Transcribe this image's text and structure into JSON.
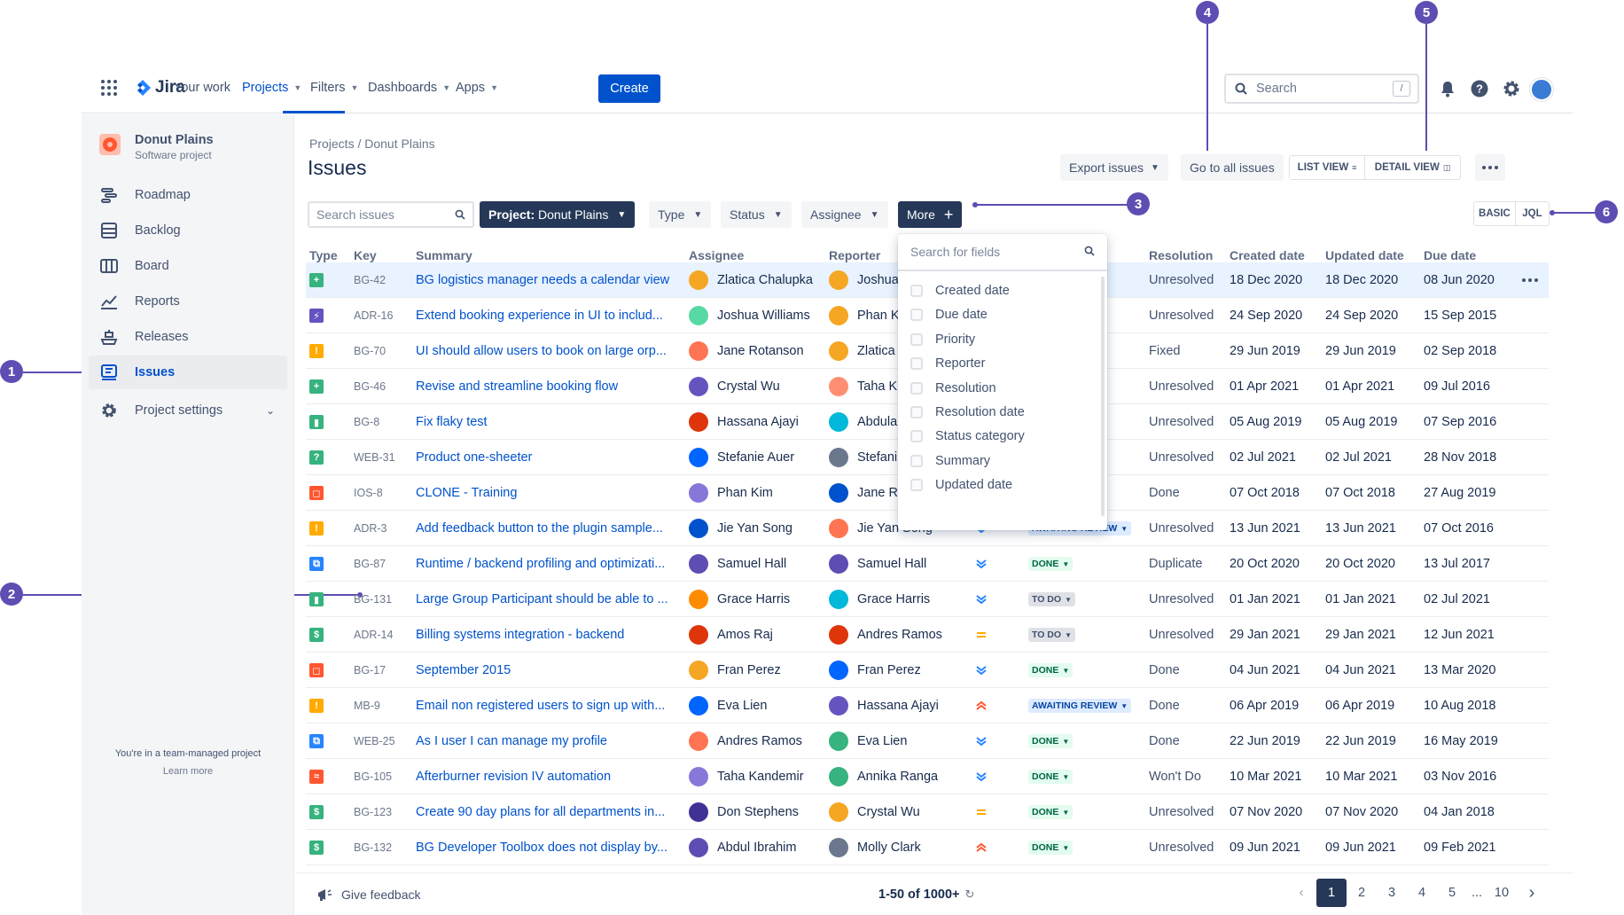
{
  "topnav": {
    "logo_text": "Jira",
    "your_work": "Your work",
    "projects": "Projects",
    "filters": "Filters",
    "dashboards": "Dashboards",
    "apps": "Apps",
    "create": "Create",
    "search_placeholder": "Search",
    "search_shortcut": "/"
  },
  "sidebar": {
    "project_name": "Donut Plains",
    "project_type": "Software project",
    "items": [
      {
        "label": "Roadmap",
        "icon": "roadmap-icon"
      },
      {
        "label": "Backlog",
        "icon": "backlog-icon"
      },
      {
        "label": "Board",
        "icon": "board-icon"
      },
      {
        "label": "Reports",
        "icon": "reports-icon"
      },
      {
        "label": "Releases",
        "icon": "releases-icon"
      },
      {
        "label": "Issues",
        "icon": "issues-icon"
      },
      {
        "label": "Project settings",
        "icon": "gear-icon"
      }
    ],
    "footer_text": "You're in a team-managed project",
    "footer_link": "Learn more"
  },
  "header": {
    "breadcrumb": "Projects / Donut Plains",
    "title": "Issues",
    "export": "Export issues",
    "go_all": "Go to all issues",
    "list_view": "LIST VIEW",
    "detail_view": "DETAIL VIEW"
  },
  "filters": {
    "search_placeholder": "Search issues",
    "project_prefix": "Project:",
    "project_value": "Donut Plains",
    "type": "Type",
    "status": "Status",
    "assignee": "Assignee",
    "more": "More",
    "basic": "BASIC",
    "jql": "JQL"
  },
  "columns": {
    "type": "Type",
    "key": "Key",
    "summary": "Summary",
    "assignee": "Assignee",
    "reporter": "Reporter",
    "resolution": "Resolution",
    "created": "Created date",
    "updated": "Updated date",
    "due": "Due date"
  },
  "dropdown": {
    "search_placeholder": "Search for fields",
    "options": [
      "Created date",
      "Due date",
      "Priority",
      "Reporter",
      "Resolution",
      "Resolution date",
      "Status category",
      "Summary",
      "Updated date"
    ]
  },
  "rows": [
    {
      "type": "story",
      "type_color": "#36b37e",
      "type_glyph": "+",
      "key": "BG-42",
      "summary": "BG logistics manager needs a calendar view",
      "assignee": "Zlatica Chalupka",
      "a_color": "#f5a623",
      "reporter": "Joshua",
      "r_color": "#f5a623",
      "priority": "",
      "status": "",
      "status_kind": "",
      "resolution": "Unresolved",
      "created": "18 Dec 2020",
      "updated": "18 Dec 2020",
      "due": "08 Jun 2020"
    },
    {
      "type": "epic",
      "type_color": "#6554c0",
      "type_glyph": "⚡",
      "key": "ADR-16",
      "summary": "Extend booking experience in UI to includ...",
      "assignee": "Joshua Williams",
      "a_color": "#57d9a3",
      "reporter": "Phan K",
      "r_color": "#f5a623",
      "priority": "",
      "status": "",
      "status_kind": "",
      "resolution": "Unresolved",
      "created": "24 Sep 2020",
      "updated": "24 Sep 2020",
      "due": "15 Sep 2015"
    },
    {
      "type": "idea",
      "type_color": "#ffab00",
      "type_glyph": "!",
      "key": "BG-70",
      "summary": "UI should allow users to book on large orp...",
      "assignee": "Jane Rotanson",
      "a_color": "#ff7452",
      "reporter": "Zlatica",
      "r_color": "#f5a623",
      "priority": "",
      "status": "",
      "status_kind": "",
      "resolution": "Fixed",
      "created": "29 Jun 2019",
      "updated": "29 Jun 2019",
      "due": "02 Sep 2018"
    },
    {
      "type": "story",
      "type_color": "#36b37e",
      "type_glyph": "+",
      "key": "BG-46",
      "summary": "Revise and streamline booking flow",
      "assignee": "Crystal Wu",
      "a_color": "#6554c0",
      "reporter": "Taha K",
      "r_color": "#ff8f73",
      "priority": "",
      "status": "",
      "status_kind": "",
      "resolution": "Unresolved",
      "created": "01 Apr 2021",
      "updated": "01 Apr 2021",
      "due": "09 Jul 2016"
    },
    {
      "type": "bookmark",
      "type_color": "#36b37e",
      "type_glyph": "▮",
      "key": "BG-8",
      "summary": "Fix flaky test",
      "assignee": "Hassana Ajayi",
      "a_color": "#de350b",
      "reporter": "Abdula",
      "r_color": "#00b8d9",
      "priority": "",
      "status": "",
      "status_kind": "",
      "resolution": "Unresolved",
      "created": "05 Aug 2019",
      "updated": "05 Aug 2019",
      "due": "07 Sep 2016"
    },
    {
      "type": "question",
      "type_color": "#36b37e",
      "type_glyph": "?",
      "key": "WEB-31",
      "summary": "Product one-sheeter",
      "assignee": "Stefanie Auer",
      "a_color": "#0065ff",
      "reporter": "Stefani",
      "r_color": "#6b778c",
      "priority": "",
      "status": "",
      "status_kind": "",
      "resolution": "Unresolved",
      "created": "02 Jul 2021",
      "updated": "02 Jul 2021",
      "due": "28 Nov 2018"
    },
    {
      "type": "bug",
      "type_color": "#ff5630",
      "type_glyph": "◻",
      "key": "IOS-8",
      "summary": "CLONE - Training",
      "assignee": "Phan Kim",
      "a_color": "#8777d9",
      "reporter": "Jane R",
      "r_color": "#0052cc",
      "priority": "",
      "status": "",
      "status_kind": "",
      "resolution": "Done",
      "created": "07 Oct 2018",
      "updated": "07 Oct 2018",
      "due": "27 Aug 2019"
    },
    {
      "type": "idea",
      "type_color": "#ffab00",
      "type_glyph": "!",
      "key": "ADR-3",
      "summary": "Add feedback button to the plugin sample...",
      "assignee": "Jie Yan Song",
      "a_color": "#0052cc",
      "reporter": "Jie Yan Song",
      "r_color": "#ff7452",
      "priority": "low",
      "status": "AWAITING REVIEW",
      "status_kind": "awaiting",
      "resolution": "Unresolved",
      "created": "13 Jun 2021",
      "updated": "13 Jun 2021",
      "due": "07 Oct 2016"
    },
    {
      "type": "subtask",
      "type_color": "#2684ff",
      "type_glyph": "⧉",
      "key": "BG-87",
      "summary": "Runtime / backend profiling and optimizati...",
      "assignee": "Samuel Hall",
      "a_color": "#5e4db2",
      "reporter": "Samuel Hall",
      "r_color": "#5e4db2",
      "priority": "low",
      "status": "DONE",
      "status_kind": "done",
      "resolution": "Duplicate",
      "created": "20 Oct 2020",
      "updated": "20 Oct 2020",
      "due": "13 Jul 2017"
    },
    {
      "type": "bookmark",
      "type_color": "#36b37e",
      "type_glyph": "▮",
      "key": "BG-131",
      "summary": "Large Group Participant should be able to ...",
      "assignee": "Grace Harris",
      "a_color": "#ff8b00",
      "reporter": "Grace Harris",
      "r_color": "#00b8d9",
      "priority": "low",
      "status": "TO DO",
      "status_kind": "todo",
      "resolution": "Unresolved",
      "created": "01 Jan 2021",
      "updated": "01 Jan 2021",
      "due": "02 Jul 2021"
    },
    {
      "type": "dollar",
      "type_color": "#36b37e",
      "type_glyph": "$",
      "key": "ADR-14",
      "summary": "Billing systems integration - backend",
      "assignee": "Amos Raj",
      "a_color": "#de350b",
      "reporter": "Andres Ramos",
      "r_color": "#de350b",
      "priority": "medium",
      "status": "TO DO",
      "status_kind": "todo",
      "resolution": "Unresolved",
      "created": "29 Jan 2021",
      "updated": "29 Jan 2021",
      "due": "12 Jun 2021"
    },
    {
      "type": "bug",
      "type_color": "#ff5630",
      "type_glyph": "◻",
      "key": "BG-17",
      "summary": "September 2015",
      "assignee": "Fran Perez",
      "a_color": "#f5a623",
      "reporter": "Fran Perez",
      "r_color": "#0065ff",
      "priority": "low",
      "status": "DONE",
      "status_kind": "done",
      "resolution": "Done",
      "created": "04 Jun 2021",
      "updated": "04 Jun 2021",
      "due": "13 Mar 2020"
    },
    {
      "type": "idea",
      "type_color": "#ffab00",
      "type_glyph": "!",
      "key": "MB-9",
      "summary": "Email non registered users to sign up with...",
      "assignee": "Eva Lien",
      "a_color": "#0065ff",
      "reporter": "Hassana Ajayi",
      "r_color": "#6554c0",
      "priority": "high",
      "status": "AWAITING REVIEW",
      "status_kind": "awaiting",
      "resolution": "Done",
      "created": "06 Apr 2019",
      "updated": "06 Apr 2019",
      "due": "10 Aug 2018"
    },
    {
      "type": "subtask",
      "type_color": "#2684ff",
      "type_glyph": "⧉",
      "key": "WEB-25",
      "summary": "As I user I can manage my profile",
      "assignee": "Andres Ramos",
      "a_color": "#ff7452",
      "reporter": "Eva Lien",
      "r_color": "#36b37e",
      "priority": "low",
      "status": "DONE",
      "status_kind": "done",
      "resolution": "Done",
      "created": "22 Jun 2019",
      "updated": "22 Jun 2019",
      "due": "16 May 2019"
    },
    {
      "type": "incident",
      "type_color": "#ff5630",
      "type_glyph": "≈",
      "key": "BG-105",
      "summary": "Afterburner revision IV automation",
      "assignee": "Taha Kandemir",
      "a_color": "#8777d9",
      "reporter": "Annika Ranga",
      "r_color": "#36b37e",
      "priority": "low",
      "status": "DONE",
      "status_kind": "done",
      "resolution": "Won't Do",
      "created": "10 Mar 2021",
      "updated": "10 Mar 2021",
      "due": "03 Nov 2016"
    },
    {
      "type": "dollar",
      "type_color": "#36b37e",
      "type_glyph": "$",
      "key": "BG-123",
      "summary": "Create 90 day plans for all departments in...",
      "assignee": "Don Stephens",
      "a_color": "#403294",
      "reporter": "Crystal Wu",
      "r_color": "#f5a623",
      "priority": "medium",
      "status": "DONE",
      "status_kind": "done",
      "resolution": "Unresolved",
      "created": "07 Nov 2020",
      "updated": "07 Nov 2020",
      "due": "04 Jan 2018"
    },
    {
      "type": "dollar",
      "type_color": "#36b37e",
      "type_glyph": "$",
      "key": "BG-132",
      "summary": "BG Developer Toolbox does not display by...",
      "assignee": "Abdul Ibrahim",
      "a_color": "#5e4db2",
      "reporter": "Molly Clark",
      "r_color": "#6b778c",
      "priority": "high",
      "status": "DONE",
      "status_kind": "done",
      "resolution": "Unresolved",
      "created": "09 Jun 2021",
      "updated": "09 Jun 2021",
      "due": "09 Feb 2021"
    }
  ],
  "footer": {
    "feedback": "Give feedback",
    "count": "1-50 of 1000+",
    "pages": [
      "1",
      "2",
      "3",
      "4",
      "5",
      "...",
      "10"
    ]
  },
  "callouts": [
    "1",
    "2",
    "3",
    "4",
    "5",
    "6"
  ],
  "colors": {
    "brand": "#0052cc",
    "callout": "#5e4db2",
    "dark_button": "#253858"
  }
}
